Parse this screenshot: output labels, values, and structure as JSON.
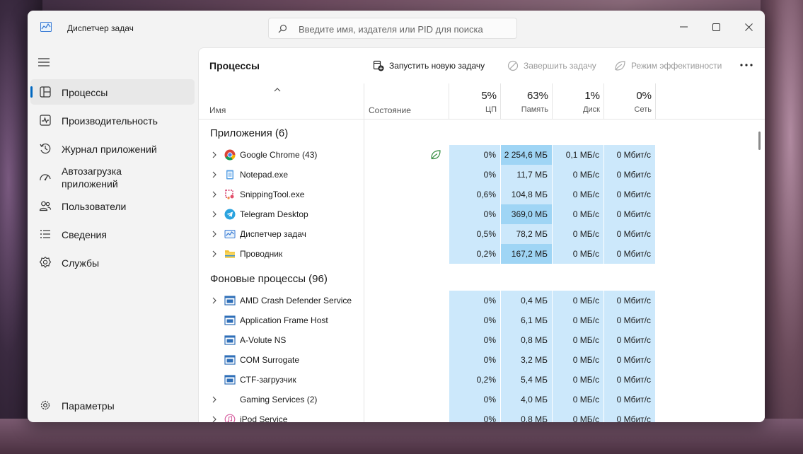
{
  "window": {
    "title": "Диспетчер задач"
  },
  "search": {
    "placeholder": "Введите имя, издателя или PID для поиска",
    "value": ""
  },
  "sidebar": {
    "items": [
      {
        "label": "Процессы",
        "icon": "processes-icon",
        "active": true
      },
      {
        "label": "Производительность",
        "icon": "performance-icon"
      },
      {
        "label": "Журнал приложений",
        "icon": "history-icon"
      },
      {
        "label_line1": "Автозагрузка",
        "label_line2": "приложений",
        "icon": "startup-icon"
      },
      {
        "label": "Пользователи",
        "icon": "users-icon"
      },
      {
        "label": "Сведения",
        "icon": "details-icon"
      },
      {
        "label": "Службы",
        "icon": "services-icon"
      }
    ],
    "settings_label": "Параметры"
  },
  "toolbar": {
    "page_title": "Процессы",
    "run_task_label": "Запустить новую задачу",
    "end_task_label": "Завершить задачу",
    "efficiency_label": "Режим эффективности"
  },
  "columns": {
    "name": "Имя",
    "status": "Состояние",
    "cpu_pct": "5%",
    "cpu_label": "ЦП",
    "mem_pct": "63%",
    "mem_label": "Память",
    "disk_pct": "1%",
    "disk_label": "Диск",
    "net_pct": "0%",
    "net_label": "Сеть"
  },
  "apps_section": {
    "title": "Приложения (6)",
    "rows": [
      {
        "name": "Google Chrome (43)",
        "icon": "chrome-icon",
        "cpu": "0%",
        "mem": "2 254,6 МБ",
        "disk": "0,1 МБ/с",
        "net": "0 Мбит/с",
        "mem_hot": true,
        "eco": true,
        "expandable": true
      },
      {
        "name": "Notepad.exe",
        "icon": "notepad-icon",
        "cpu": "0%",
        "mem": "11,7 МБ",
        "disk": "0 МБ/с",
        "net": "0 Мбит/с",
        "expandable": true
      },
      {
        "name": "SnippingTool.exe",
        "icon": "snipping-tool-icon",
        "cpu": "0,6%",
        "mem": "104,8 МБ",
        "disk": "0 МБ/с",
        "net": "0 Мбит/с",
        "expandable": true
      },
      {
        "name": "Telegram Desktop",
        "icon": "telegram-icon",
        "cpu": "0%",
        "mem": "369,0 МБ",
        "disk": "0 МБ/с",
        "net": "0 Мбит/с",
        "mem_hot": true,
        "expandable": true
      },
      {
        "name": "Диспетчер задач",
        "icon": "task-manager-icon",
        "cpu": "0,5%",
        "mem": "78,2 МБ",
        "disk": "0 МБ/с",
        "net": "0 Мбит/с",
        "expandable": true
      },
      {
        "name": "Проводник",
        "icon": "explorer-folder-icon",
        "cpu": "0,2%",
        "mem": "167,2 МБ",
        "disk": "0 МБ/с",
        "net": "0 Мбит/с",
        "mem_hot": true,
        "expandable": true
      }
    ]
  },
  "bg_section": {
    "title": "Фоновые процессы (96)",
    "rows": [
      {
        "name": "AMD Crash Defender Service",
        "icon": "service-window-icon",
        "cpu": "0%",
        "mem": "0,4 МБ",
        "disk": "0 МБ/с",
        "net": "0 Мбит/с",
        "expandable": true
      },
      {
        "name": "Application Frame Host",
        "icon": "service-window-icon",
        "cpu": "0%",
        "mem": "6,1 МБ",
        "disk": "0 МБ/с",
        "net": "0 Мбит/с",
        "expandable": false
      },
      {
        "name": "A-Volute NS",
        "icon": "service-window-icon",
        "cpu": "0%",
        "mem": "0,8 МБ",
        "disk": "0 МБ/с",
        "net": "0 Мбит/с",
        "expandable": false
      },
      {
        "name": "COM Surrogate",
        "icon": "service-window-icon",
        "cpu": "0%",
        "mem": "3,2 МБ",
        "disk": "0 МБ/с",
        "net": "0 Мбит/с",
        "expandable": false
      },
      {
        "name": "CTF-загрузчик",
        "icon": "service-window-icon",
        "cpu": "0,2%",
        "mem": "5,4 МБ",
        "disk": "0 МБ/с",
        "net": "0 Мбит/с",
        "expandable": false
      },
      {
        "name": "Gaming Services (2)",
        "icon": "",
        "cpu": "0%",
        "mem": "4,0 МБ",
        "disk": "0 МБ/с",
        "net": "0 Мбит/с",
        "expandable": true
      },
      {
        "name": "iPod Service",
        "icon": "ipod-service-icon",
        "cpu": "0%",
        "mem": "0,8 МБ",
        "disk": "0 МБ/с",
        "net": "0 Мбит/с",
        "expandable": true
      }
    ]
  },
  "colors": {
    "accent": "#0067c0",
    "cell": "#cce8fb",
    "cell_hot": "#9fd5f5"
  }
}
